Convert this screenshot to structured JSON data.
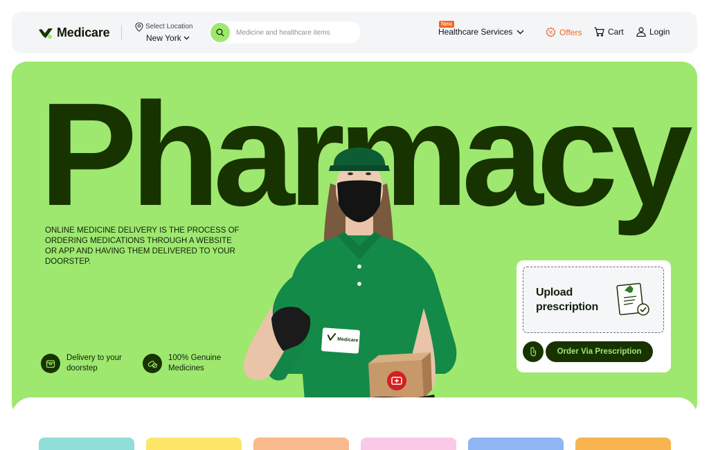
{
  "brand": {
    "name": "Medicare",
    "accent": "#9fe870",
    "dark": "#163300",
    "orange": "#f26522"
  },
  "location": {
    "label": "Select Location",
    "value": "New York"
  },
  "search": {
    "placeholder": "Medicine and healthcare items"
  },
  "nav": {
    "healthcare_badge": "New",
    "healthcare_label": "Healthcare Services",
    "offers_label": "Offers",
    "cart_label": "Cart",
    "login_label": "Login"
  },
  "hero": {
    "title": "Pharmacy",
    "description": "ONLINE MEDICINE DELIVERY IS THE PROCESS OF ORDERING MEDICATIONS THROUGH A WEBSITE OR APP AND HAVING THEM DELIVERED TO YOUR DOORSTEP.",
    "features": [
      {
        "text": "Delivery to your doorstep",
        "icon": "delivery-box-icon"
      },
      {
        "text": "100% Genuine Medicines",
        "icon": "pills-icon"
      }
    ],
    "card_brand": "Medicare"
  },
  "upload": {
    "title": "Upload prescription",
    "order_button": "Order Via Prescription"
  },
  "categories": [
    {
      "color": "#8fdfd8"
    },
    {
      "color": "#fde567"
    },
    {
      "color": "#f8b98c"
    },
    {
      "color": "#f9c9e6"
    },
    {
      "color": "#8fb5f2"
    },
    {
      "color": "#f8b450"
    }
  ]
}
